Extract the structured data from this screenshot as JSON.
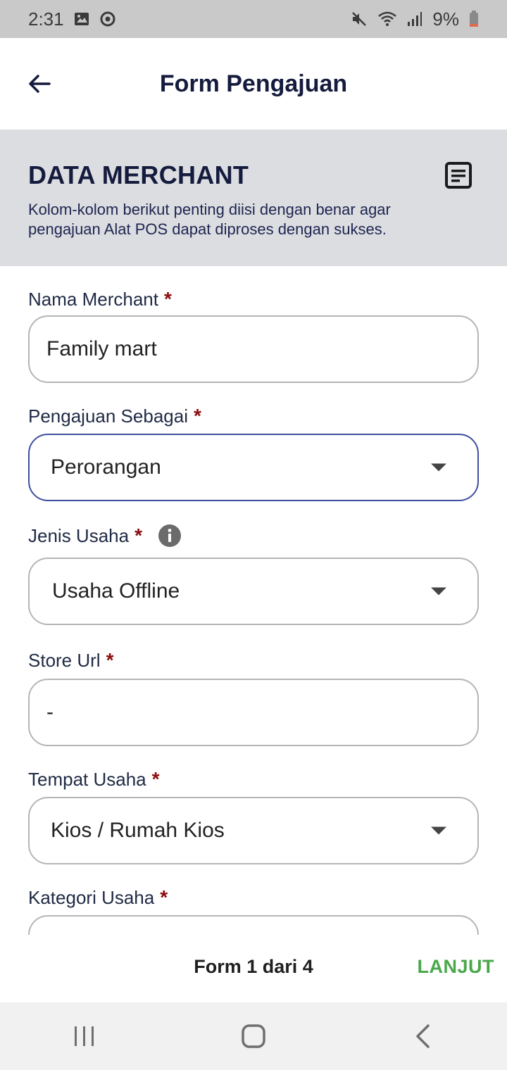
{
  "status_bar": {
    "time": "2:31",
    "battery": "9%",
    "icons": [
      "image-icon",
      "sync-icon",
      "mute-icon",
      "wifi-icon",
      "signal-icon",
      "battery-icon"
    ]
  },
  "app_bar": {
    "title": "Form Pengajuan",
    "back_icon": "arrow-left-icon"
  },
  "section": {
    "title": "DATA MERCHANT",
    "description": "Kolom-kolom berikut penting diisi dengan benar agar pengajuan Alat POS dapat diproses dengan sukses.",
    "icon": "document-icon"
  },
  "form": {
    "fields": [
      {
        "label": "Nama Merchant",
        "required": "*",
        "type": "text",
        "value": "Family mart"
      },
      {
        "label": "Pengajuan Sebagai",
        "required": "*",
        "type": "select",
        "value": "Perorangan",
        "focused": true
      },
      {
        "label": "Jenis Usaha",
        "required": "*",
        "type": "select",
        "value": "Usaha Offline",
        "info_icon": "info-icon"
      },
      {
        "label": "Store Url",
        "required": "*",
        "type": "text",
        "value": "-"
      },
      {
        "label": "Tempat Usaha",
        "required": "*",
        "type": "select",
        "value": "Kios / Rumah Kios"
      },
      {
        "label": "Kategori Usaha",
        "required": "*",
        "type": "select",
        "value": ""
      }
    ]
  },
  "footer": {
    "step_text": "Form 1 dari 4",
    "next_label": "LANJUT"
  },
  "colors": {
    "primary_dark": "#141b3d",
    "required_red": "#8b0e0e",
    "next_green": "#4aa84c",
    "focus_border": "#3f4ea0",
    "header_bg": "#dcdde1"
  },
  "nav_bar": {
    "icons": [
      "recent-apps-icon",
      "home-icon",
      "back-icon"
    ]
  }
}
